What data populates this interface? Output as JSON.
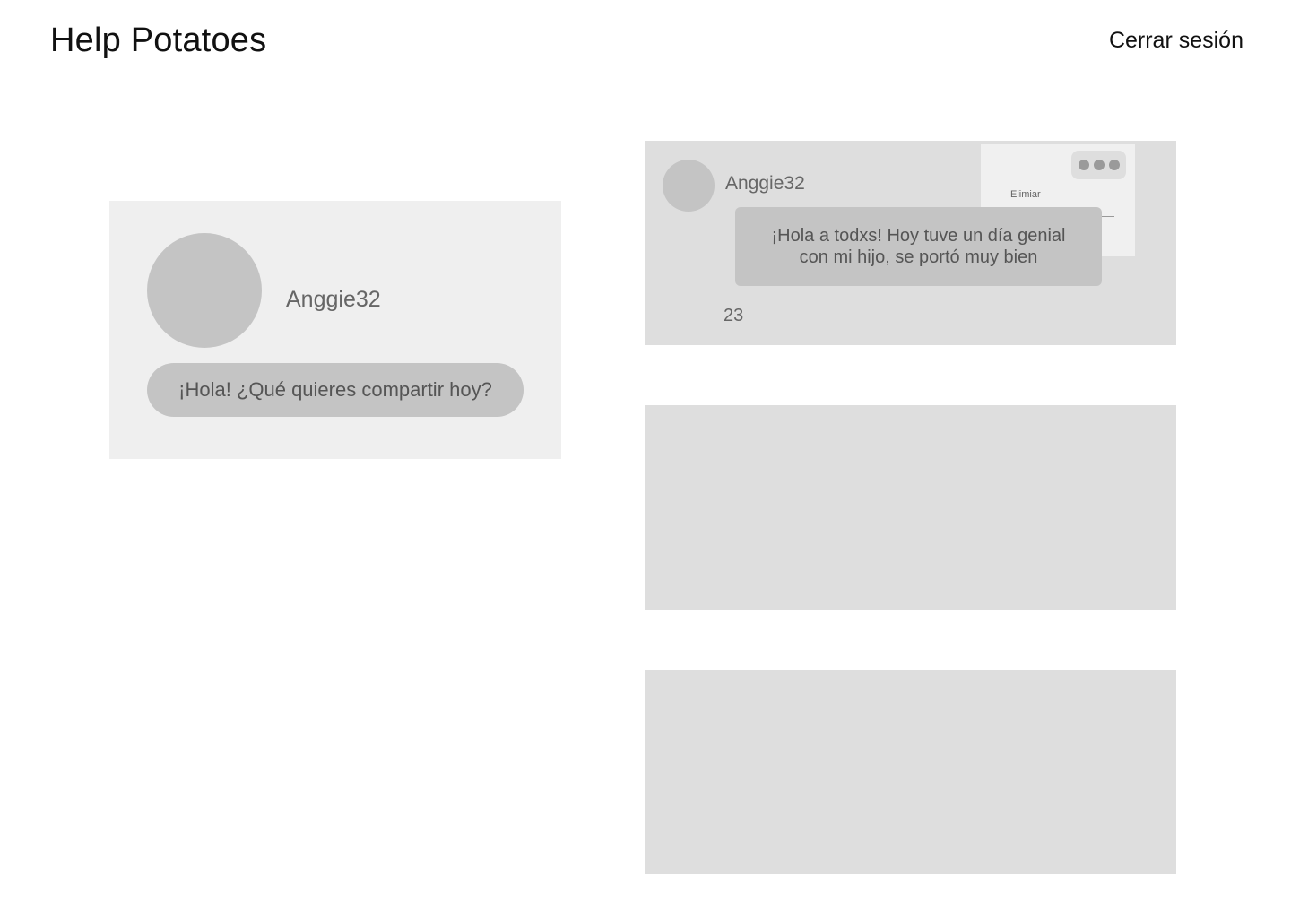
{
  "header": {
    "title": "Help Potatoes",
    "logout_label": "Cerrar sesión"
  },
  "composer": {
    "username": "Anggie32",
    "prompt": "¡Hola! ¿Qué quieres compartir hoy?"
  },
  "feed": {
    "posts": [
      {
        "username": "Anggie32",
        "text": "¡Hola a todxs! Hoy tuve un día genial con mi hijo, se portó muy bien",
        "count": "23",
        "menu": {
          "items": [
            "Elimiar"
          ]
        }
      }
    ]
  },
  "colors": {
    "background": "#ffffff",
    "composer_bg": "#efefef",
    "post_bg": "#dedede",
    "placeholder": "#c4c4c4",
    "text_muted": "#666666"
  },
  "icons": {
    "menu": "more-horizontal-icon"
  }
}
